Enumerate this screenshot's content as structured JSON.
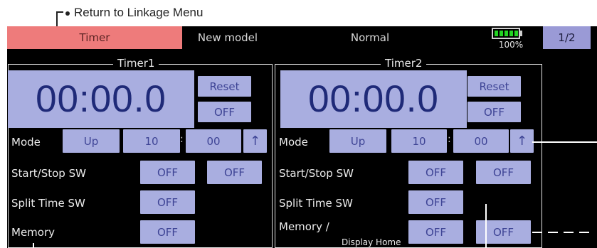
{
  "annotation": {
    "return_note": "Return to Linkage Menu"
  },
  "header": {
    "tab_label": "Timer",
    "model_name": "New model",
    "condition": "Normal",
    "battery_percent": "100%",
    "battery_level": 1.0,
    "page_indicator": "1/2"
  },
  "timer1": {
    "title": "Timer1",
    "time": "00:00.0",
    "reset_label": "Reset",
    "reset_state": "OFF",
    "mode_label": "Mode",
    "mode_value": "Up",
    "minutes": "10",
    "colon": ":",
    "seconds": "00",
    "direction_arrow": "↑",
    "start_stop_label": "Start/Stop SW",
    "start_sw": "OFF",
    "stop_sw": "OFF",
    "split_label": "Split Time SW",
    "split_sw": "OFF",
    "memory_label": "Memory",
    "memory_sw": "OFF"
  },
  "timer2": {
    "title": "Timer2",
    "time": "00:00.0",
    "reset_label": "Reset",
    "reset_state": "OFF",
    "mode_label": "Mode",
    "mode_value": "Up",
    "minutes": "10",
    "colon": ":",
    "seconds": "00",
    "direction_arrow": "↑",
    "start_stop_label": "Start/Stop SW",
    "start_sw": "OFF",
    "stop_sw": "OFF",
    "split_label": "Split Time SW",
    "split_sw": "OFF",
    "memory_label": "Memory /",
    "display_home_label": "Display Home",
    "memory_sw": "OFF",
    "display_home_sw": "OFF"
  },
  "colors": {
    "tab_active": "#ee7b7b",
    "button": "#a9aee0",
    "button_text": "#3e4495",
    "screen_bg": "#000000",
    "battery": "#22d422"
  }
}
